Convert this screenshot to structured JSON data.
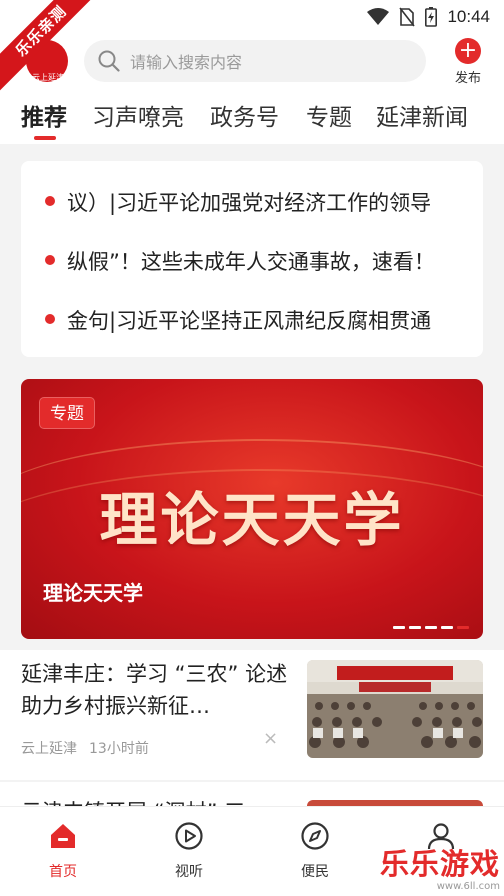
{
  "status_bar": {
    "time": "10:44"
  },
  "corner_badge": "乐乐亲测",
  "header": {
    "logo_text": "云上延津",
    "search_placeholder": "请输入搜索内容",
    "publish_label": "发布",
    "publish_symbol": "+"
  },
  "tabs": [
    {
      "label": "推荐",
      "active": true
    },
    {
      "label": "习声嘹亮",
      "active": false
    },
    {
      "label": "政务号",
      "active": false
    },
    {
      "label": "专题",
      "active": false
    },
    {
      "label": "延津新闻",
      "active": false
    }
  ],
  "news_ticker": [
    "议）|习近平论加强党对经济工作的领导",
    "纵假”！这些未成年人交通事故，速看！",
    "金句|习近平论坚持正风肃纪反腐相贯通"
  ],
  "banner": {
    "tag": "专题",
    "headline": "理论天天学",
    "caption": "理论天天学",
    "slide_count": 5,
    "active_slide": 4
  },
  "article": {
    "title": "延津丰庄：学习 “三农” 论述 助力乡村振兴新征…",
    "source": "云上延津",
    "time": "13小时前",
    "close_symbol": "×"
  },
  "next_article": {
    "title_partial": "云津丰镇开展 “深村” 三"
  },
  "bottom_nav": [
    {
      "label": "首页",
      "icon": "home-icon",
      "active": true
    },
    {
      "label": "视听",
      "icon": "play-circle-icon",
      "active": false
    },
    {
      "label": "便民",
      "icon": "compass-icon",
      "active": false
    },
    {
      "label": "",
      "icon": "user-icon",
      "active": false
    }
  ],
  "watermark": {
    "main": "乐乐游戏",
    "sub": "www.6ll.com"
  },
  "colors": {
    "accent": "#e32b2b",
    "banner_red": "#c8141a"
  }
}
